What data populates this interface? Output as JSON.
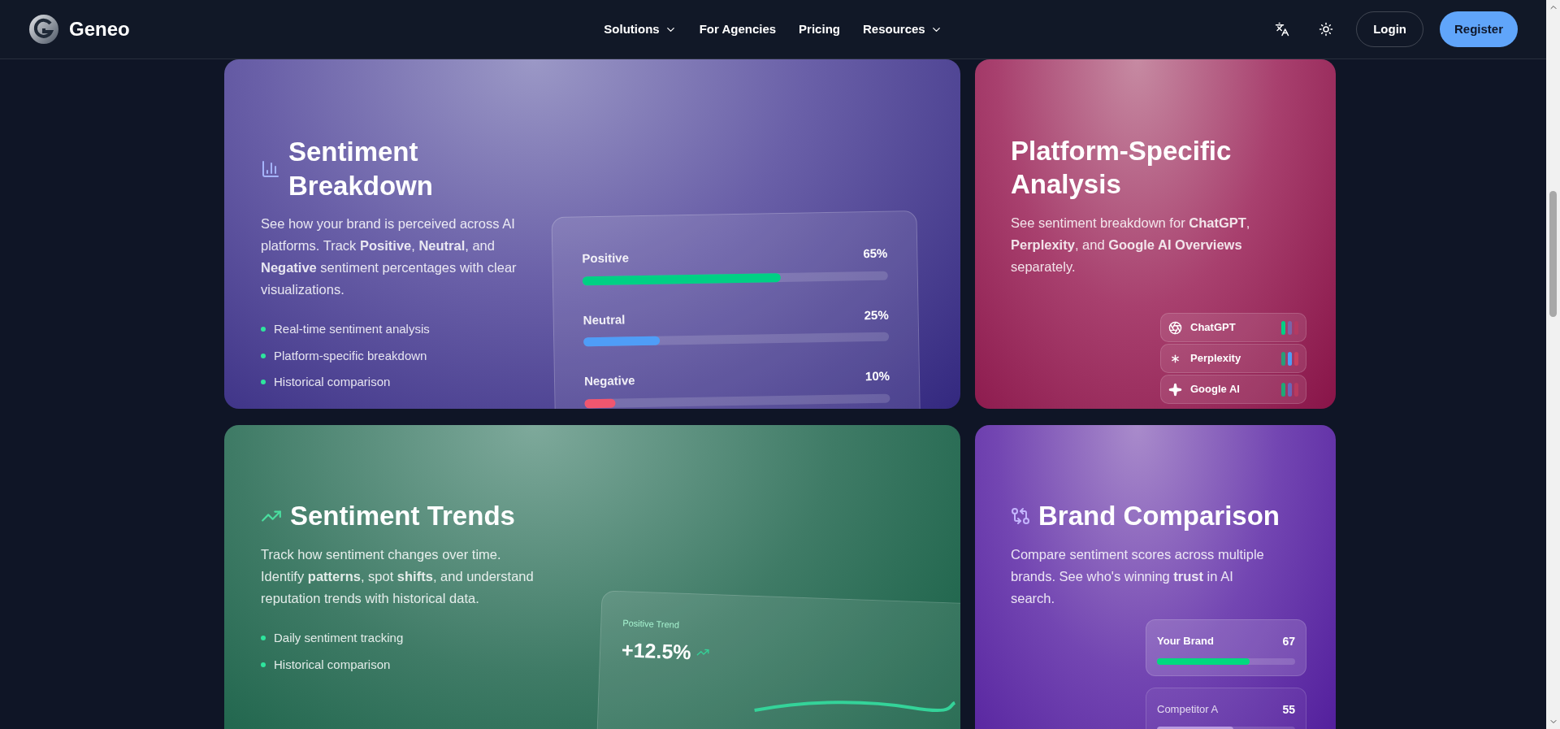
{
  "header": {
    "logo": "Geneo",
    "nav": [
      {
        "label": "Solutions",
        "dropdown": true
      },
      {
        "label": "For Agencies",
        "dropdown": false
      },
      {
        "label": "Pricing",
        "dropdown": false
      },
      {
        "label": "Resources",
        "dropdown": true
      }
    ],
    "login": "Login",
    "register": "Register"
  },
  "sentiment_breakdown": {
    "title": "Sentiment Breakdown",
    "description": "See how your brand is perceived across AI platforms. Track **Positive**, **Neutral**, and **Negative** sentiment percentages with clear visualizations.",
    "bullets": [
      "Real-time sentiment analysis",
      "Platform-specific breakdown",
      "Historical comparison"
    ],
    "bars": [
      {
        "label": "Positive",
        "value": "65%",
        "level": 0.65,
        "color": "#00d084"
      },
      {
        "label": "Neutral",
        "value": "25%",
        "level": 0.25,
        "color": "#4f9df7"
      },
      {
        "label": "Negative",
        "value": "10%",
        "level": 0.1,
        "color": "#f0566f"
      }
    ]
  },
  "platform_analysis": {
    "title": "Platform-Specific Analysis",
    "description": "See sentiment breakdown for **ChatGPT**, **Perplexity**, and **Google AI Overviews** separately.",
    "platforms": [
      {
        "name": "ChatGPT",
        "kind": "chatgpt",
        "bars": [
          {
            "color": "#00d084"
          },
          {
            "color": "#7a64a8"
          },
          {
            "color": "#b33a62"
          }
        ]
      },
      {
        "name": "Perplexity",
        "kind": "perplexity",
        "bars": [
          {
            "color": "#2a9d78"
          },
          {
            "color": "#4f9df7"
          },
          {
            "color": "#c8405f"
          }
        ]
      },
      {
        "name": "Google AI",
        "kind": "google",
        "bars": [
          {
            "color": "#1fa876"
          },
          {
            "color": "#6a66b8"
          },
          {
            "color": "#b83a5f"
          }
        ]
      }
    ]
  },
  "sentiment_trends": {
    "title": "Sentiment Trends",
    "description": "Track how sentiment changes over time. Identify **patterns**, spot **shifts**, and understand reputation trends with historical data.",
    "bullets": [
      "Daily sentiment tracking",
      "Historical comparison"
    ],
    "trend_label": "Positive Trend",
    "trend_value": "+12.5%"
  },
  "brand_comparison": {
    "title": "Brand Comparison",
    "description": "Compare sentiment scores across multiple brands. See who's winning **trust** in AI search.",
    "brands": [
      {
        "name": "Your Brand",
        "score": "67",
        "level": 0.67,
        "highlighted": true
      },
      {
        "name": "Competitor A",
        "score": "55",
        "level": 0.55,
        "highlighted": false
      }
    ]
  }
}
